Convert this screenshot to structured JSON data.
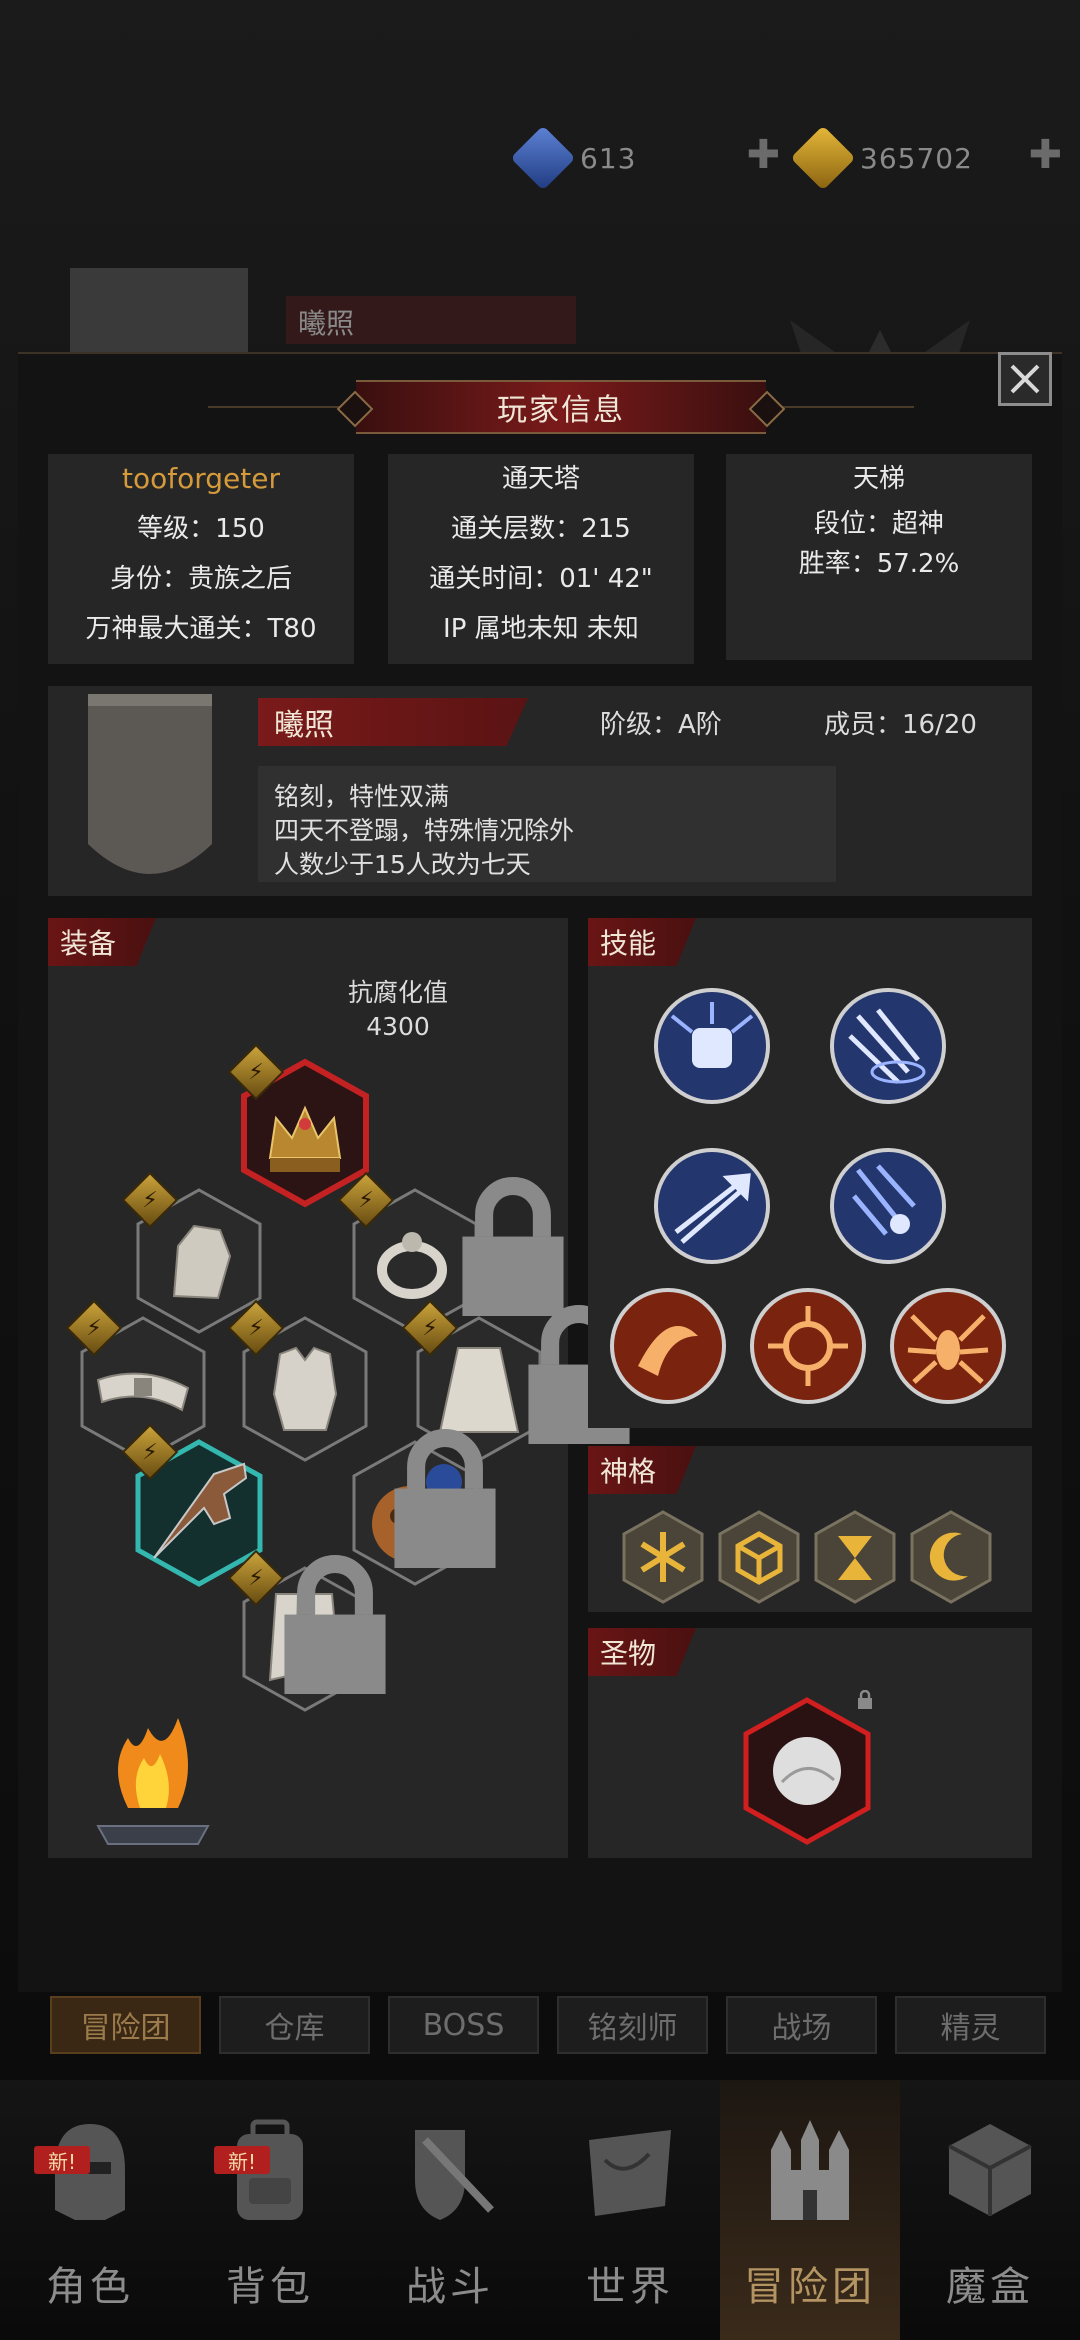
{
  "currency": {
    "diamonds": "613",
    "gold": "365702"
  },
  "background": {
    "guild_name": "曦照"
  },
  "modal": {
    "title": "玩家信息",
    "player": {
      "name": "tooforgeter",
      "level": "等级：150",
      "identity": "身份：贵族之后",
      "max_clear": "万神最大通关：T80"
    },
    "tower": {
      "title": "通天塔",
      "floors": "通关层数：215",
      "time": "通关时间：01' 42\"",
      "ip": "IP 属地未知 未知"
    },
    "ladder": {
      "title": "天梯",
      "rank": "段位：超神",
      "win_rate": "胜率：57.2%"
    },
    "guild": {
      "name": "曦照",
      "tier": "阶级：A阶",
      "members": "成员：16/20",
      "notice": [
        "铭刻，特性双满",
        "四天不登蹋，特殊情况除外",
        "人数少于15人改为七天"
      ]
    },
    "equipment": {
      "title": "装备",
      "corrosion_label": "抗腐化值",
      "corrosion_value": "4300"
    },
    "skills": {
      "title": "技能"
    },
    "divinity": {
      "title": "神格"
    },
    "relic": {
      "title": "圣物"
    }
  },
  "subtabs": [
    "冒险团",
    "仓库",
    "BOSS",
    "铭刻师",
    "战场",
    "精灵"
  ],
  "nav": {
    "items": [
      "角色",
      "背包",
      "战斗",
      "世界",
      "冒险团",
      "魔盒"
    ],
    "badge": "新!"
  },
  "colors": {
    "accent_red": "#7a1a1a",
    "gold_text": "#d49a3b",
    "panel": "#262626"
  }
}
